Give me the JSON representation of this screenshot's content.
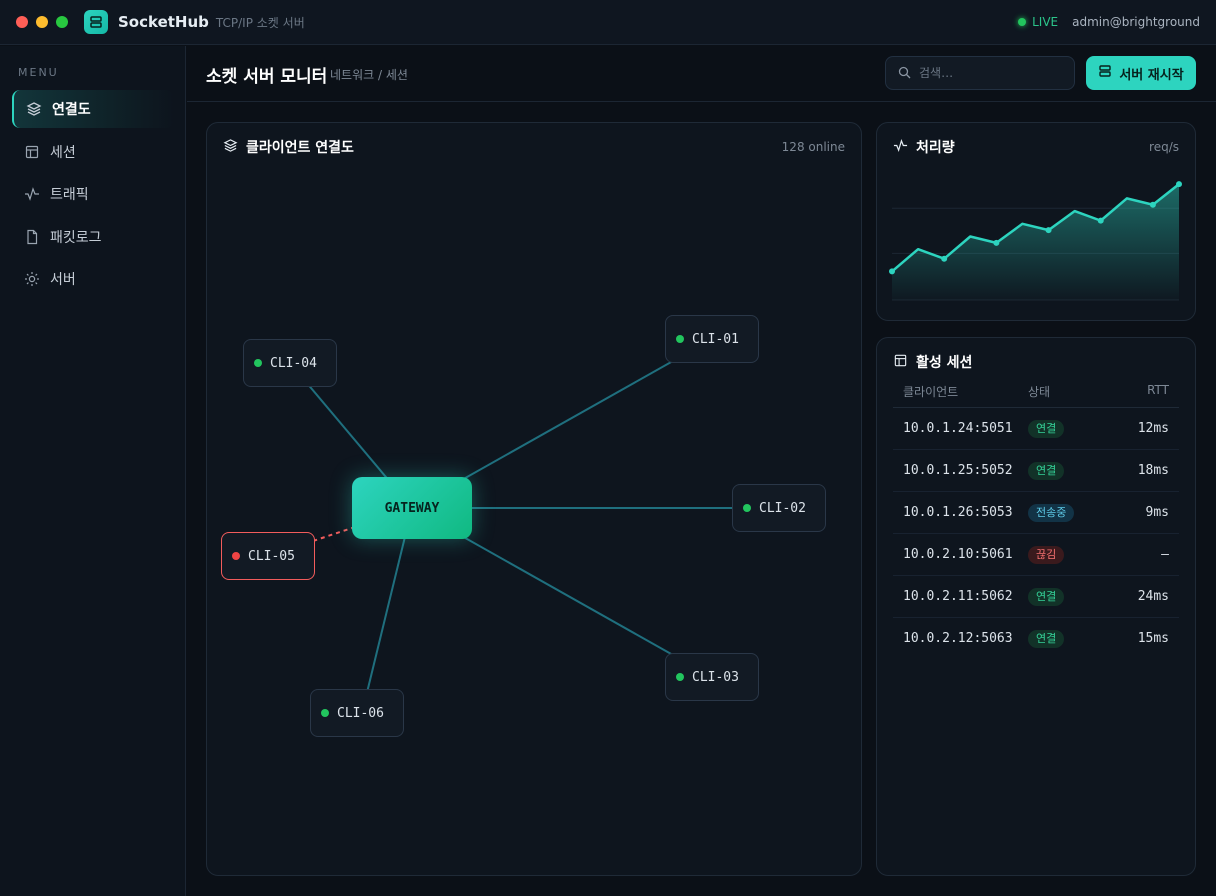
{
  "app": {
    "name": "SocketHub",
    "subtitle": "TCP/IP 소켓 서버",
    "live_label": "LIVE",
    "user": "admin@brightground"
  },
  "sidebar": {
    "menu_label": "MENU",
    "items": [
      {
        "label": "연결도",
        "icon": "layers-icon",
        "active": true
      },
      {
        "label": "세션",
        "icon": "table-icon"
      },
      {
        "label": "트래픽",
        "icon": "pulse-icon"
      },
      {
        "label": "패킷로그",
        "icon": "file-icon"
      },
      {
        "label": "서버",
        "icon": "sun-gear-icon"
      }
    ]
  },
  "header": {
    "title": "소켓 서버 모니터",
    "breadcrumb": "네트워크 / 세션",
    "search_placeholder": "검색…",
    "restart_label": "서버 재시작"
  },
  "graph": {
    "title": "클라이언트 연결도",
    "meta": "128 online",
    "gateway_label": "GATEWAY",
    "nodes": [
      {
        "id": "CLI-01",
        "status": "online"
      },
      {
        "id": "CLI-02",
        "status": "online"
      },
      {
        "id": "CLI-03",
        "status": "online"
      },
      {
        "id": "CLI-04",
        "status": "online"
      },
      {
        "id": "CLI-05",
        "status": "disconnected"
      },
      {
        "id": "CLI-06",
        "status": "online"
      }
    ]
  },
  "traffic": {
    "title": "처리량",
    "unit": "req/s"
  },
  "chart_data": {
    "type": "area",
    "title": "처리량",
    "ylabel": "req/s",
    "values": [
      18,
      32,
      26,
      40,
      36,
      48,
      44,
      56,
      50,
      64,
      60,
      73
    ],
    "ylim": [
      0,
      80
    ],
    "grid": true
  },
  "sessions": {
    "title": "활성 세션",
    "columns": [
      "클라이언트",
      "상태",
      "RTT"
    ],
    "rows": [
      {
        "addr": "10.0.1.24:5051",
        "status": "연결",
        "kind": "ok",
        "rtt": "12ms"
      },
      {
        "addr": "10.0.1.25:5052",
        "status": "연결",
        "kind": "ok",
        "rtt": "18ms"
      },
      {
        "addr": "10.0.1.26:5053",
        "status": "전송중",
        "kind": "tx",
        "rtt": "9ms"
      },
      {
        "addr": "10.0.2.10:5061",
        "status": "끊김",
        "kind": "err",
        "rtt": "—"
      },
      {
        "addr": "10.0.2.11:5062",
        "status": "연결",
        "kind": "ok",
        "rtt": "24ms"
      },
      {
        "addr": "10.0.2.12:5063",
        "status": "연결",
        "kind": "ok",
        "rtt": "15ms"
      }
    ]
  },
  "colors": {
    "accent": "#2dd4bf",
    "online": "#22c55e",
    "offline": "#ef4444"
  }
}
